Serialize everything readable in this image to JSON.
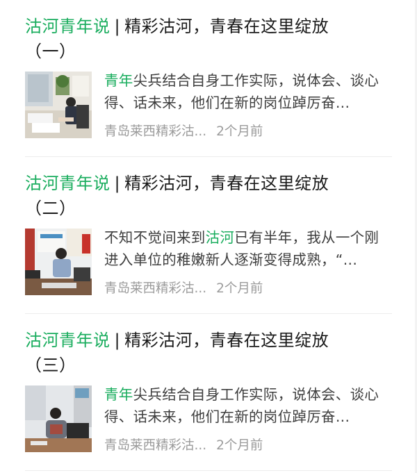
{
  "articles": [
    {
      "title_keyword": "沽河青年说",
      "title_separator": "|",
      "title_rest": "精彩沽河，青春在这里绽放",
      "title_suffix": "（一）",
      "summary_keyword": "青年",
      "summary_rest": "尖兵结合自身工作实际，说体会、谈心得、话未来，他们在新的岗位踔厉奋",
      "summary_ellipsis": "...",
      "source": "青岛莱西精彩沽...",
      "time": "2个月前",
      "thumb_icon": "woman-writing-at-desk-photo"
    },
    {
      "title_keyword": "沽河青年说",
      "title_separator": "|",
      "title_rest": "精彩沽河，青春在这里绽放",
      "title_suffix": "（二）",
      "summary_pre": "不知不觉间来到",
      "summary_keyword": "沽河",
      "summary_rest": "已有半年，我从一个刚进入单位的稚嫩新人逐渐变得成熟，“",
      "summary_ellipsis": "...",
      "source": "青岛莱西精彩沽...",
      "time": "2个月前",
      "thumb_icon": "man-at-computer-photo"
    },
    {
      "title_keyword": "沽河青年说",
      "title_separator": "|",
      "title_rest": "精彩沽河，青春在这里绽放",
      "title_suffix": "（三）",
      "summary_keyword": "青年",
      "summary_rest": "尖兵结合自身工作实际，说体会、谈心得、话未来，他们在新的岗位踔厉奋",
      "summary_ellipsis": "...",
      "source": "青岛莱西精彩沽...",
      "time": "2个月前",
      "thumb_icon": "woman-at-computer-photo"
    }
  ],
  "colors": {
    "keyword": "#1aad5e",
    "title": "#1a1a1a",
    "summary": "#3e3e3e",
    "meta": "#9b9b9b"
  }
}
